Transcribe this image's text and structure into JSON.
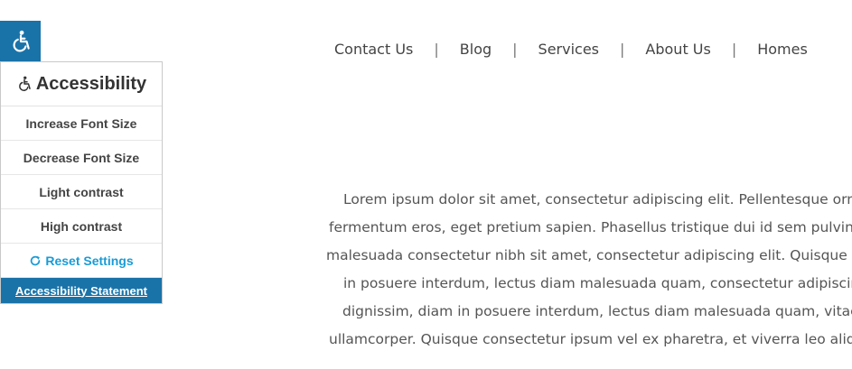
{
  "accessibility": {
    "toggle_icon": "wheelchair-icon",
    "title": "Accessibility",
    "items": [
      {
        "label": "Increase Font Size"
      },
      {
        "label": "Decrease Font Size"
      },
      {
        "label": "Light contrast"
      },
      {
        "label": "High contrast"
      }
    ],
    "reset_label": "Reset Settings",
    "statement_label": "Accessibility Statement",
    "accent_color": "#1a73a8",
    "reset_color": "#1a9bd6"
  },
  "nav": {
    "items": [
      "Contact Us",
      "Blog",
      "Services",
      "About Us",
      "Homes"
    ],
    "separator": "|"
  },
  "content": {
    "lines": [
      "Lorem ipsum dolor sit amet, consectetur adipiscing elit. Pellentesque orn",
      "fermentum eros, eget pretium sapien. Phasellus tristique dui id sem pulvina",
      "malesuada consectetur nibh sit amet, consectetur adipiscing elit. Quisque c",
      "in posuere interdum, lectus diam malesuada quam, consectetur adipiscin",
      "dignissim, diam in posuere interdum, lectus diam malesuada quam, vitae",
      "ullamcorper. Quisque consectetur ipsum vel ex pharetra, et viverra leo aliqu"
    ]
  }
}
